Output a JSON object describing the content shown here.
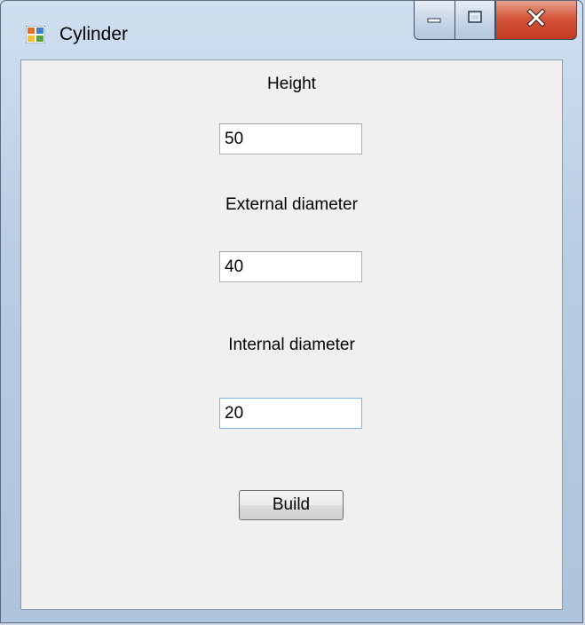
{
  "window": {
    "title": "Cylinder",
    "icon": "winforms-app-icon"
  },
  "controls": {
    "minimize_icon": "minimize-icon",
    "maximize_icon": "maximize-icon",
    "close_icon": "close-icon"
  },
  "form": {
    "height_label": "Height",
    "height_value": "50",
    "external_label": "External diameter",
    "external_value": "40",
    "internal_label": "Internal diameter",
    "internal_value": "20",
    "build_label": "Build"
  },
  "colors": {
    "client_bg": "#f0f0f0",
    "close_button": "#c94a2e",
    "focus_border": "#7eb4ea"
  }
}
